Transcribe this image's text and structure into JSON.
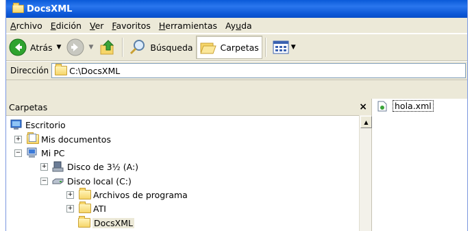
{
  "window": {
    "title": "DocsXML"
  },
  "menu": [
    "Archivo",
    "Edición",
    "Ver",
    "Favoritos",
    "Herramientas",
    "Ayuda"
  ],
  "menu_underline": [
    "A",
    "E",
    "V",
    "F",
    "H",
    "u"
  ],
  "toolbar": {
    "back": "Atrás",
    "search": "Búsqueda",
    "folders": "Carpetas"
  },
  "address": {
    "label": "Dirección",
    "value": "C:\\DocsXML"
  },
  "folders_pane": {
    "title": "Carpetas",
    "close": "×"
  },
  "tree": [
    {
      "label": "Escritorio",
      "icon": "desktop-icon",
      "toggle": ""
    },
    {
      "label": "Mis documentos",
      "icon": "documents-icon",
      "toggle": "+"
    },
    {
      "label": "Mi PC",
      "icon": "computer-icon",
      "toggle": "−"
    },
    {
      "label": "Disco de 3½ (A:)",
      "icon": "floppy-icon",
      "toggle": "+"
    },
    {
      "label": "Disco local (C:)",
      "icon": "harddisk-icon",
      "toggle": "−"
    },
    {
      "label": "Archivos de programa",
      "icon": "folder-icon",
      "toggle": "+"
    },
    {
      "label": "ATI",
      "icon": "folder-icon",
      "toggle": "+"
    },
    {
      "label": "DocsXML",
      "icon": "open-folder-icon",
      "toggle": ""
    }
  ],
  "files": [
    {
      "name": "hola.xml",
      "icon": "xml-file-icon"
    }
  ]
}
